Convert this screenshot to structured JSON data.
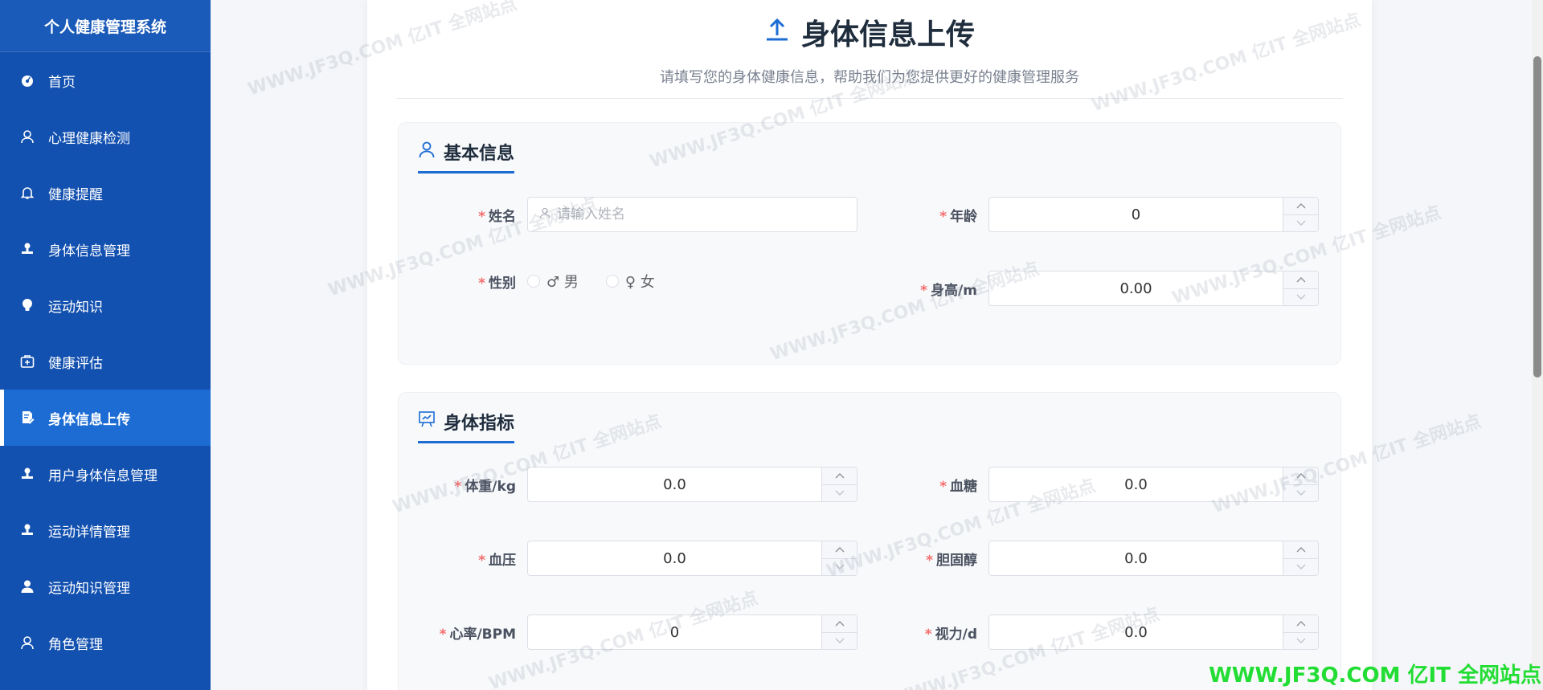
{
  "sidebar": {
    "title": "个人健康管理系统",
    "items": [
      {
        "label": "首页",
        "icon": "dashboard-icon"
      },
      {
        "label": "心理健康检测",
        "icon": "user-icon"
      },
      {
        "label": "健康提醒",
        "icon": "bell-icon"
      },
      {
        "label": "身体信息管理",
        "icon": "stamp-icon"
      },
      {
        "label": "运动知识",
        "icon": "lightbulb-icon"
      },
      {
        "label": "健康评估",
        "icon": "first-aid-icon"
      },
      {
        "label": "身体信息上传",
        "icon": "edit-document-icon",
        "active": true
      },
      {
        "label": "用户身体信息管理",
        "icon": "stamp-icon"
      },
      {
        "label": "运动详情管理",
        "icon": "stamp-icon"
      },
      {
        "label": "运动知识管理",
        "icon": "avatar-icon"
      },
      {
        "label": "角色管理",
        "icon": "user-icon"
      }
    ]
  },
  "header": {
    "title": "身体信息上传",
    "subtitle": "请填写您的身体健康信息，帮助我们为您提供更好的健康管理服务"
  },
  "basic": {
    "title": "基本信息",
    "name_label": "姓名",
    "name_placeholder": "请输入姓名",
    "age_label": "年龄",
    "age_value": "0",
    "gender_label": "性别",
    "gender_male": "♂ 男",
    "gender_female": "♀ 女",
    "height_label": "身高/m",
    "height_value": "0.00"
  },
  "metrics": {
    "title": "身体指标",
    "weight_label": "体重/kg",
    "weight_value": "0.0",
    "sugar_label": "血糖",
    "sugar_value": "0.0",
    "pressure_label": "血压",
    "pressure_value": "0.0",
    "cholesterol_label": "胆固醇",
    "cholesterol_value": "0.0",
    "heartrate_label": "心率/BPM",
    "heartrate_value": "0",
    "vision_label": "视力/d",
    "vision_value": "0.0"
  },
  "required_mark": "*",
  "watermark": {
    "text": "WWW.JF3Q.COM 亿IT 全网站点",
    "corner": "WWW.JF3Q.COM 亿IT 全网站点"
  },
  "colors": {
    "sidebar_bg": "#1351b0",
    "active_bg": "#1c6cd4",
    "accent": "#1c6cd4",
    "required": "#f56c6c",
    "corner_watermark": "#22dd33"
  }
}
